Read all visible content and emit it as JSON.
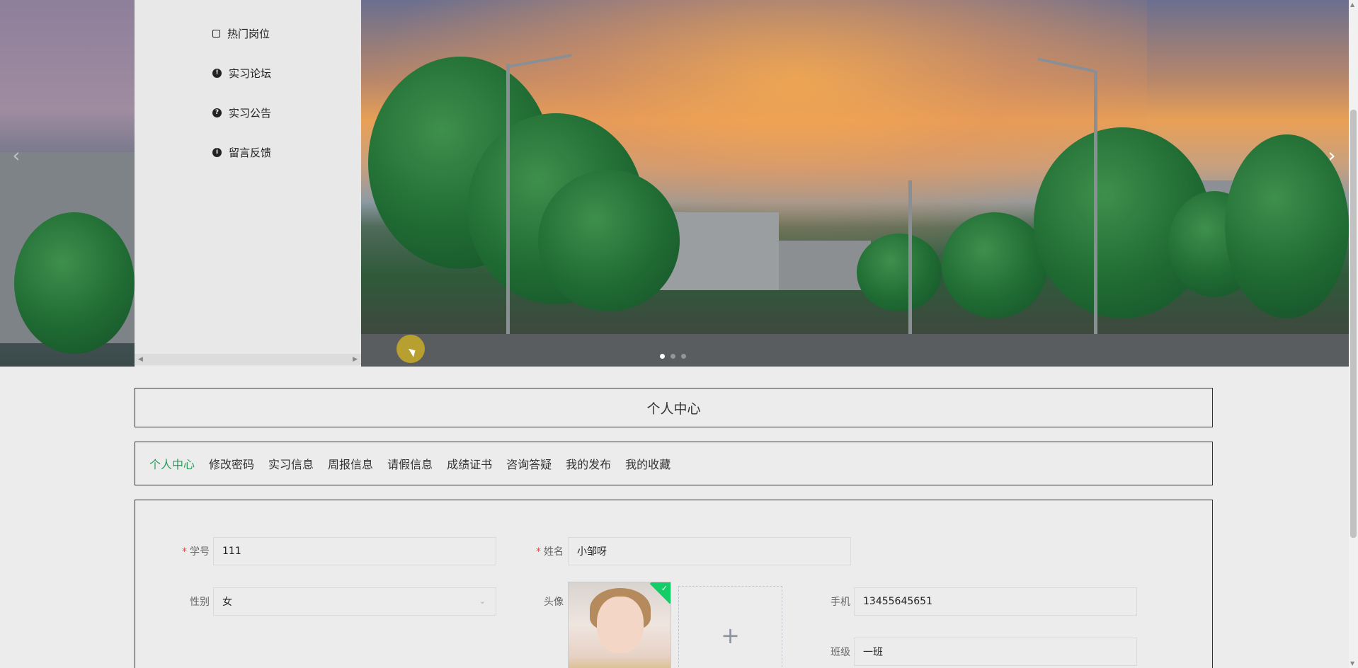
{
  "side_menu": {
    "items": [
      {
        "label": "热门岗位",
        "icon": "bag-icon"
      },
      {
        "label": "实习论坛",
        "icon": "exclamation-circle-icon"
      },
      {
        "label": "实习公告",
        "icon": "question-circle-icon"
      },
      {
        "label": "留言反馈",
        "icon": "info-circle-icon"
      }
    ]
  },
  "carousel": {
    "prev_label": "‹",
    "next_label": "›",
    "active_index": 0,
    "dots": 3
  },
  "section_title": "个人中心",
  "tabs": [
    {
      "label": "个人中心",
      "active": true
    },
    {
      "label": "修改密码"
    },
    {
      "label": "实习信息"
    },
    {
      "label": "周报信息"
    },
    {
      "label": "请假信息"
    },
    {
      "label": "成绩证书"
    },
    {
      "label": "咨询答疑"
    },
    {
      "label": "我的发布"
    },
    {
      "label": "我的收藏"
    }
  ],
  "form": {
    "student_id": {
      "label": "学号",
      "value": "111",
      "required": true
    },
    "name": {
      "label": "姓名",
      "value": "小邹呀",
      "required": true
    },
    "gender": {
      "label": "性别",
      "value": "女"
    },
    "avatar": {
      "label": "头像",
      "upload_plus": "+"
    },
    "phone": {
      "label": "手机",
      "value": "13455645651"
    },
    "class": {
      "label": "班级",
      "value": "一班"
    }
  },
  "colors": {
    "accent": "#2c9c5c",
    "required": "#e04848",
    "success": "#13ce66"
  }
}
